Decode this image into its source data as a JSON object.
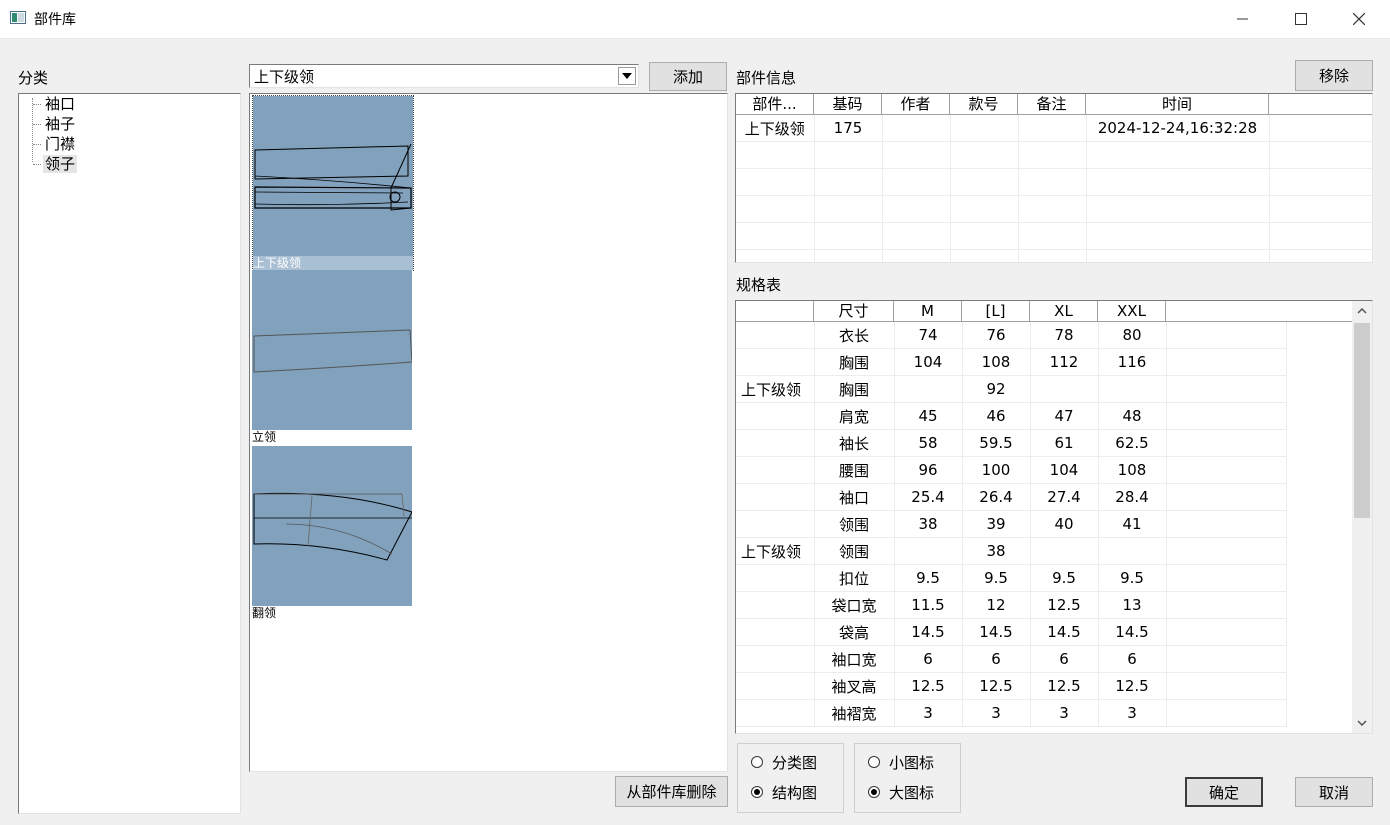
{
  "window": {
    "title": "部件库"
  },
  "category": {
    "label": "分类",
    "items": [
      "袖口",
      "袖子",
      "门襟",
      "领子"
    ],
    "selected_index": 3
  },
  "parts": {
    "dropdown_value": "上下级领",
    "add_label": "添加",
    "delete_label": "从部件库删除",
    "items": [
      {
        "caption": "上下级领",
        "selected": true
      },
      {
        "caption": "立领",
        "selected": false
      },
      {
        "caption": "翻领",
        "selected": false
      }
    ]
  },
  "part_info": {
    "label": "部件信息",
    "remove_label": "移除",
    "columns": [
      "部件...",
      "基码",
      "作者",
      "款号",
      "备注",
      "时间"
    ],
    "rows": [
      [
        "上下级领",
        "175",
        "",
        "",
        "",
        "2024-12-24,16:32:28"
      ]
    ]
  },
  "spec": {
    "label": "规格表",
    "columns": [
      "",
      "尺寸",
      "M",
      "[L]",
      "XL",
      "XXL"
    ],
    "rows": [
      [
        "",
        "衣长",
        "74",
        "76",
        "78",
        "80"
      ],
      [
        "",
        "胸围",
        "104",
        "108",
        "112",
        "116"
      ],
      [
        "上下级领",
        "胸围",
        "",
        "92",
        "",
        ""
      ],
      [
        "",
        "肩宽",
        "45",
        "46",
        "47",
        "48"
      ],
      [
        "",
        "袖长",
        "58",
        "59.5",
        "61",
        "62.5"
      ],
      [
        "",
        "腰围",
        "96",
        "100",
        "104",
        "108"
      ],
      [
        "",
        "袖口",
        "25.4",
        "26.4",
        "27.4",
        "28.4"
      ],
      [
        "",
        "领围",
        "38",
        "39",
        "40",
        "41"
      ],
      [
        "上下级领",
        "领围",
        "",
        "38",
        "",
        ""
      ],
      [
        "",
        "扣位",
        "9.5",
        "9.5",
        "9.5",
        "9.5"
      ],
      [
        "",
        "袋口宽",
        "11.5",
        "12",
        "12.5",
        "13"
      ],
      [
        "",
        "袋高",
        "14.5",
        "14.5",
        "14.5",
        "14.5"
      ],
      [
        "",
        "袖口宽",
        "6",
        "6",
        "6",
        "6"
      ],
      [
        "",
        "袖叉高",
        "12.5",
        "12.5",
        "12.5",
        "12.5"
      ],
      [
        "",
        "袖褶宽",
        "3",
        "3",
        "3",
        "3"
      ]
    ]
  },
  "view_mode": {
    "option1": "分类图",
    "option2": "结构图",
    "selected": "option2"
  },
  "icon_size": {
    "option1": "小图标",
    "option2": "大图标",
    "selected": "option2"
  },
  "ok_label": "确定",
  "cancel_label": "取消"
}
